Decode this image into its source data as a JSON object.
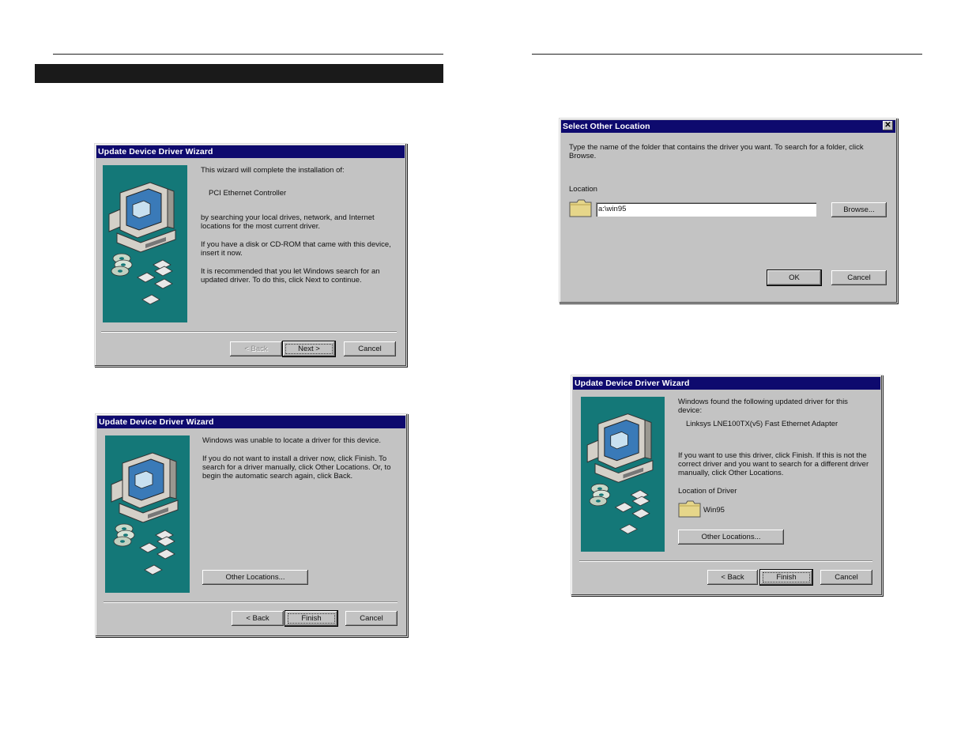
{
  "wizard1": {
    "title": "Update Device Driver Wizard",
    "line1": "This wizard will complete the installation of:",
    "device": "PCI Ethernet Controller",
    "para1": "by searching your local drives, network, and Internet locations for the most current driver.",
    "para2": "If you have a disk or CD-ROM that came with this device, insert it now.",
    "para3": "It is recommended that you let Windows search for an updated driver. To do this, click Next to continue.",
    "back": "< Back",
    "next": "Next >",
    "cancel": "Cancel"
  },
  "wizard2": {
    "title": "Update Device Driver Wizard",
    "line1": "Windows was unable to locate a driver for this device.",
    "para1": "If you do not want to install a driver now, click Finish. To search for a driver manually, click Other Locations. Or, to begin the automatic search again, click Back.",
    "other": "Other Locations...",
    "back": "< Back",
    "finish": "Finish",
    "cancel": "Cancel"
  },
  "select": {
    "title": "Select Other Location",
    "close": "✕",
    "instructions": "Type the name of the folder that contains the driver you want. To search for a folder, click Browse.",
    "location_label": "Location",
    "location_value": "a:\\win95",
    "browse": "Browse...",
    "ok": "OK",
    "cancel": "Cancel"
  },
  "wizard3": {
    "title": "Update Device Driver Wizard",
    "line1": "Windows found the following updated driver for this device:",
    "device": "Linksys LNE100TX(v5) Fast Ethernet Adapter",
    "para1": "If you want to use this driver, click Finish. If this is not the correct driver and you want to search for a different driver manually, click Other Locations.",
    "location_label": "Location of Driver",
    "folder_name": "Win95",
    "other": "Other Locations...",
    "back": "< Back",
    "finish": "Finish",
    "cancel": "Cancel"
  },
  "icons": [
    "computer-icon",
    "cd-icon",
    "floppy-disk-icon",
    "folder-icon",
    "close-icon"
  ]
}
